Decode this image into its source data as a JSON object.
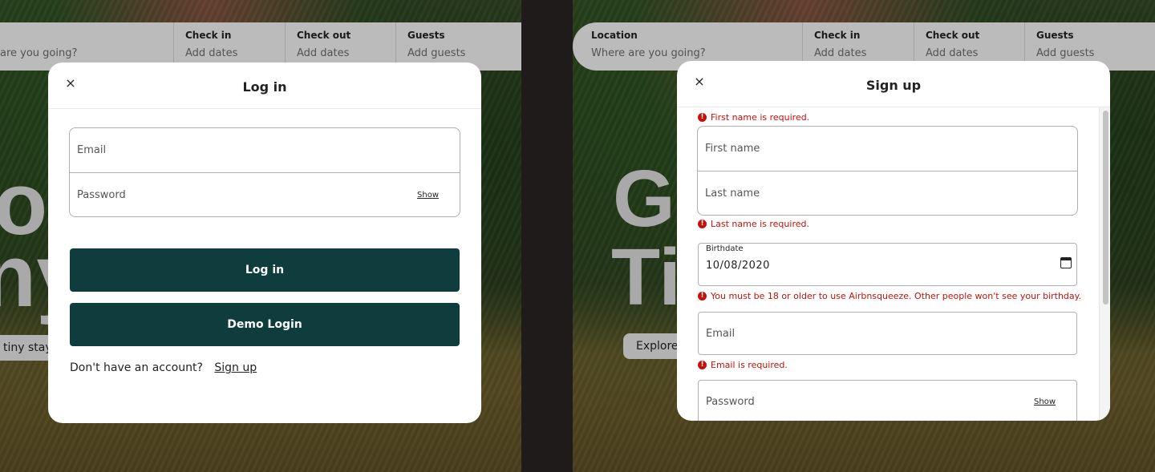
{
  "search": {
    "location_label": "Location",
    "location_value": "Where are you going?",
    "checkin_label": "Check in",
    "checkin_value": "Add dates",
    "checkout_label": "Check out",
    "checkout_value": "Add dates",
    "guests_label": "Guests",
    "guests_value": "Add guests"
  },
  "left": {
    "search_location_value_partial": "are you going?",
    "hero_line1": "o",
    "hero_line2": "ny",
    "hero_button": "tiny stays"
  },
  "right": {
    "hero_line1": "Ge",
    "hero_line2": "Ti",
    "hero_button": "Explore"
  },
  "login": {
    "title": "Log in",
    "close": "×",
    "email_placeholder": "Email",
    "password_placeholder": "Password",
    "show_label": "Show",
    "login_button": "Log in",
    "demo_button": "Demo Login",
    "no_account_text": "Don't have an account?",
    "signup_link": "Sign up"
  },
  "signup": {
    "title": "Sign up",
    "close": "×",
    "first_name_error": "First name is required.",
    "first_name_placeholder": "First name",
    "last_name_placeholder": "Last name",
    "last_name_error": "Last name is required.",
    "birthdate_label": "Birthdate",
    "birthdate_value": "10/08/2020",
    "birthdate_error": "You must be 18 or older to use Airbnsqueeze. Other people won't see your birthday.",
    "email_placeholder": "Email",
    "email_error": "Email is required.",
    "password_placeholder": "Password",
    "show_label": "Show"
  },
  "colors": {
    "primary_button": "#0f3d3e",
    "error": "#c6100a"
  }
}
